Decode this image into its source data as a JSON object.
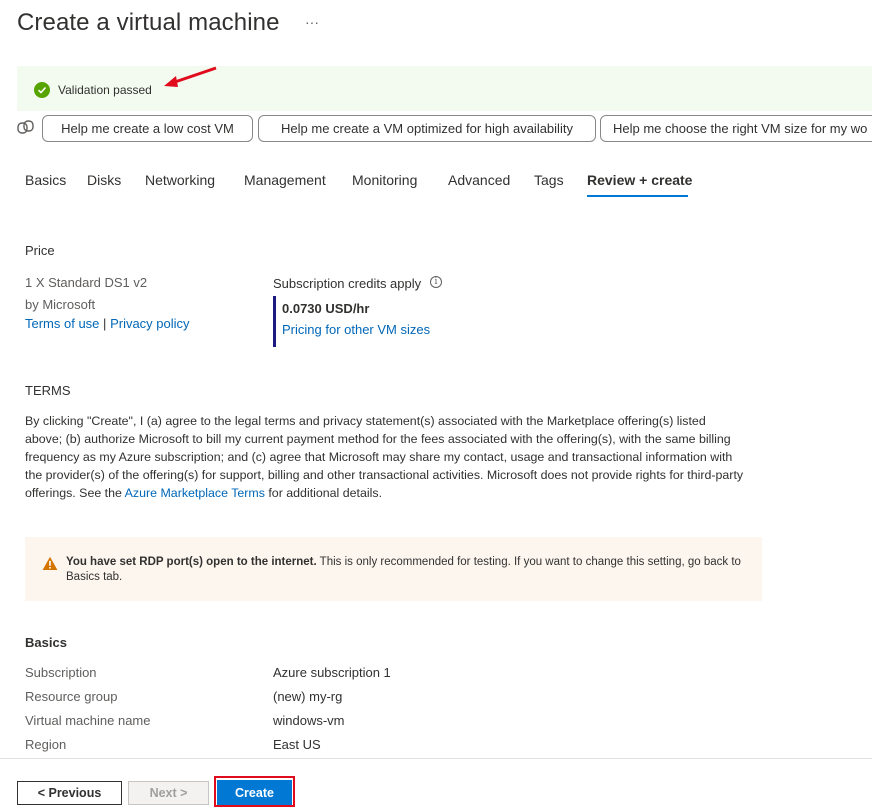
{
  "header": {
    "title": "Create a virtual machine",
    "more_label": "···"
  },
  "banner": {
    "text": "Validation passed",
    "status_color": "#57a300"
  },
  "copilot": {
    "suggestions": [
      "Help me create a low cost VM",
      "Help me create a VM optimized for high availability",
      "Help me choose the right VM size for my wo"
    ]
  },
  "tabs": [
    {
      "label": "Basics"
    },
    {
      "label": "Disks"
    },
    {
      "label": "Networking"
    },
    {
      "label": "Management"
    },
    {
      "label": "Monitoring"
    },
    {
      "label": "Advanced"
    },
    {
      "label": "Tags"
    },
    {
      "label": "Review + create",
      "active": true
    }
  ],
  "price": {
    "heading": "Price",
    "product": "1 X Standard DS1 v2",
    "publisher": "by Microsoft",
    "terms_link": "Terms of use",
    "separator": "|",
    "privacy_link": "Privacy policy",
    "credits_label": "Subscription credits apply",
    "info_glyph": "i",
    "rate": "0.0730 USD/hr",
    "pricing_link": "Pricing for other VM sizes"
  },
  "terms": {
    "heading": "TERMS",
    "body_before_link": "By clicking \"Create\", I (a) agree to the legal terms and privacy statement(s) associated with the Marketplace offering(s) listed above; (b) authorize Microsoft to bill my current payment method for the fees associated with the offering(s), with the same billing frequency as my Azure subscription; and (c) agree that Microsoft may share my contact, usage and transactional information with the provider(s) of the offering(s) for support, billing and other transactional activities. Microsoft does not provide rights for third-party offerings. See the ",
    "link": "Azure Marketplace Terms",
    "body_after_link": " for additional details."
  },
  "warning": {
    "bold": "You have set RDP port(s) open to the internet.",
    "text": "  This is only recommended for testing.  If you want to change this setting, go back to Basics tab.",
    "color": "#d47500"
  },
  "basics": {
    "heading": "Basics",
    "rows": [
      {
        "label": "Subscription",
        "value": "Azure subscription 1"
      },
      {
        "label": "Resource group",
        "value": "(new) my-rg"
      },
      {
        "label": "Virtual machine name",
        "value": "windows-vm"
      },
      {
        "label": "Region",
        "value": "East US"
      }
    ]
  },
  "footer": {
    "previous_label": "< Previous",
    "next_label": "Next >",
    "create_label": "Create"
  },
  "colors": {
    "accent": "#0078d4",
    "link": "#0067b8",
    "highlight": "#e00b1c"
  }
}
